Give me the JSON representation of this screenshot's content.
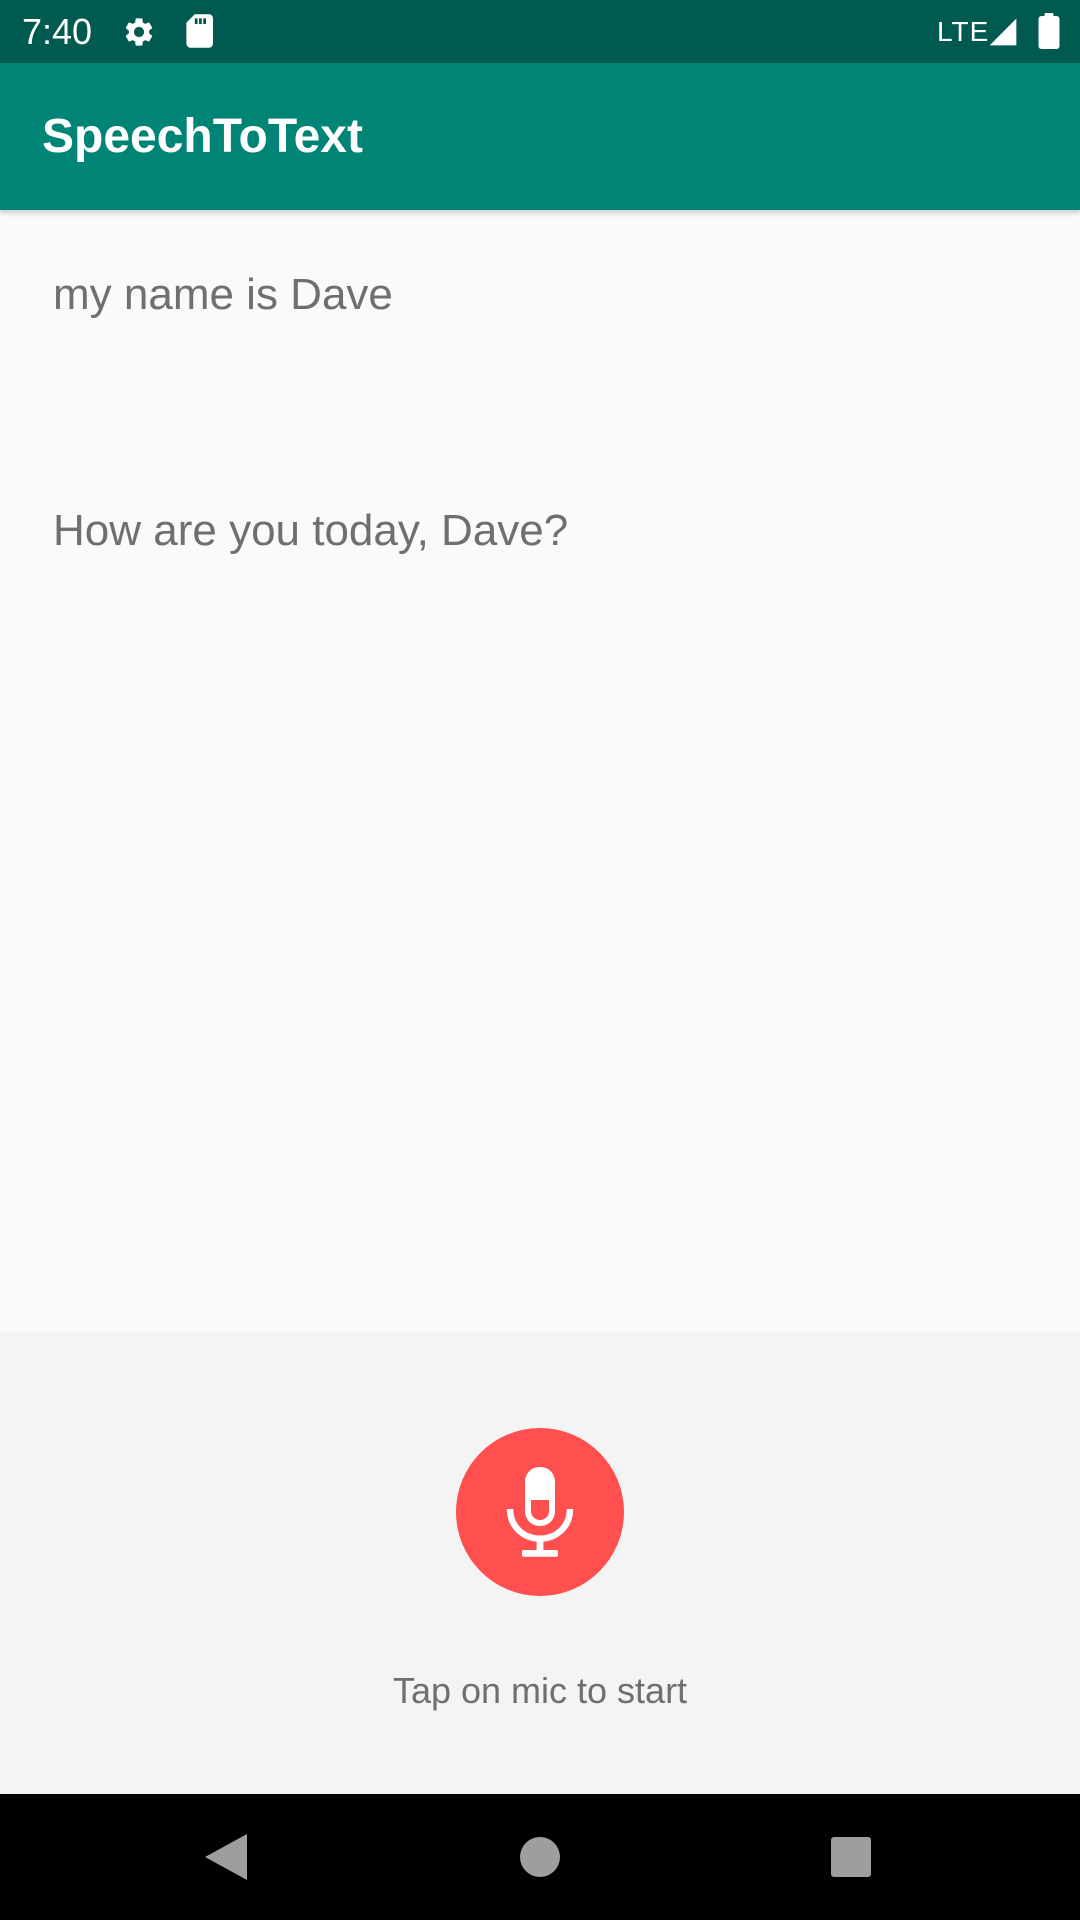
{
  "status_bar": {
    "time": "7:40",
    "network": "LTE",
    "icons": [
      "settings-icon",
      "sd-card-icon",
      "signal-icon",
      "battery-icon"
    ]
  },
  "app_bar": {
    "title": "SpeechToText"
  },
  "content": {
    "spoken_text": "my name is Dave",
    "reply_text": "How are you today, Dave?"
  },
  "controls": {
    "mic_icon": "mic-icon",
    "hint": "Tap on mic to start"
  },
  "nav_bar": {
    "icons": [
      "back-icon",
      "home-icon",
      "recents-icon"
    ]
  },
  "colors": {
    "status_bar": "#005a4f",
    "app_bar": "#008475",
    "background": "#fafafa",
    "panel": "#f4f4f4",
    "mic_button": "#ff4f4f",
    "text": "#6f6f6f",
    "nav_bar": "#000000"
  }
}
